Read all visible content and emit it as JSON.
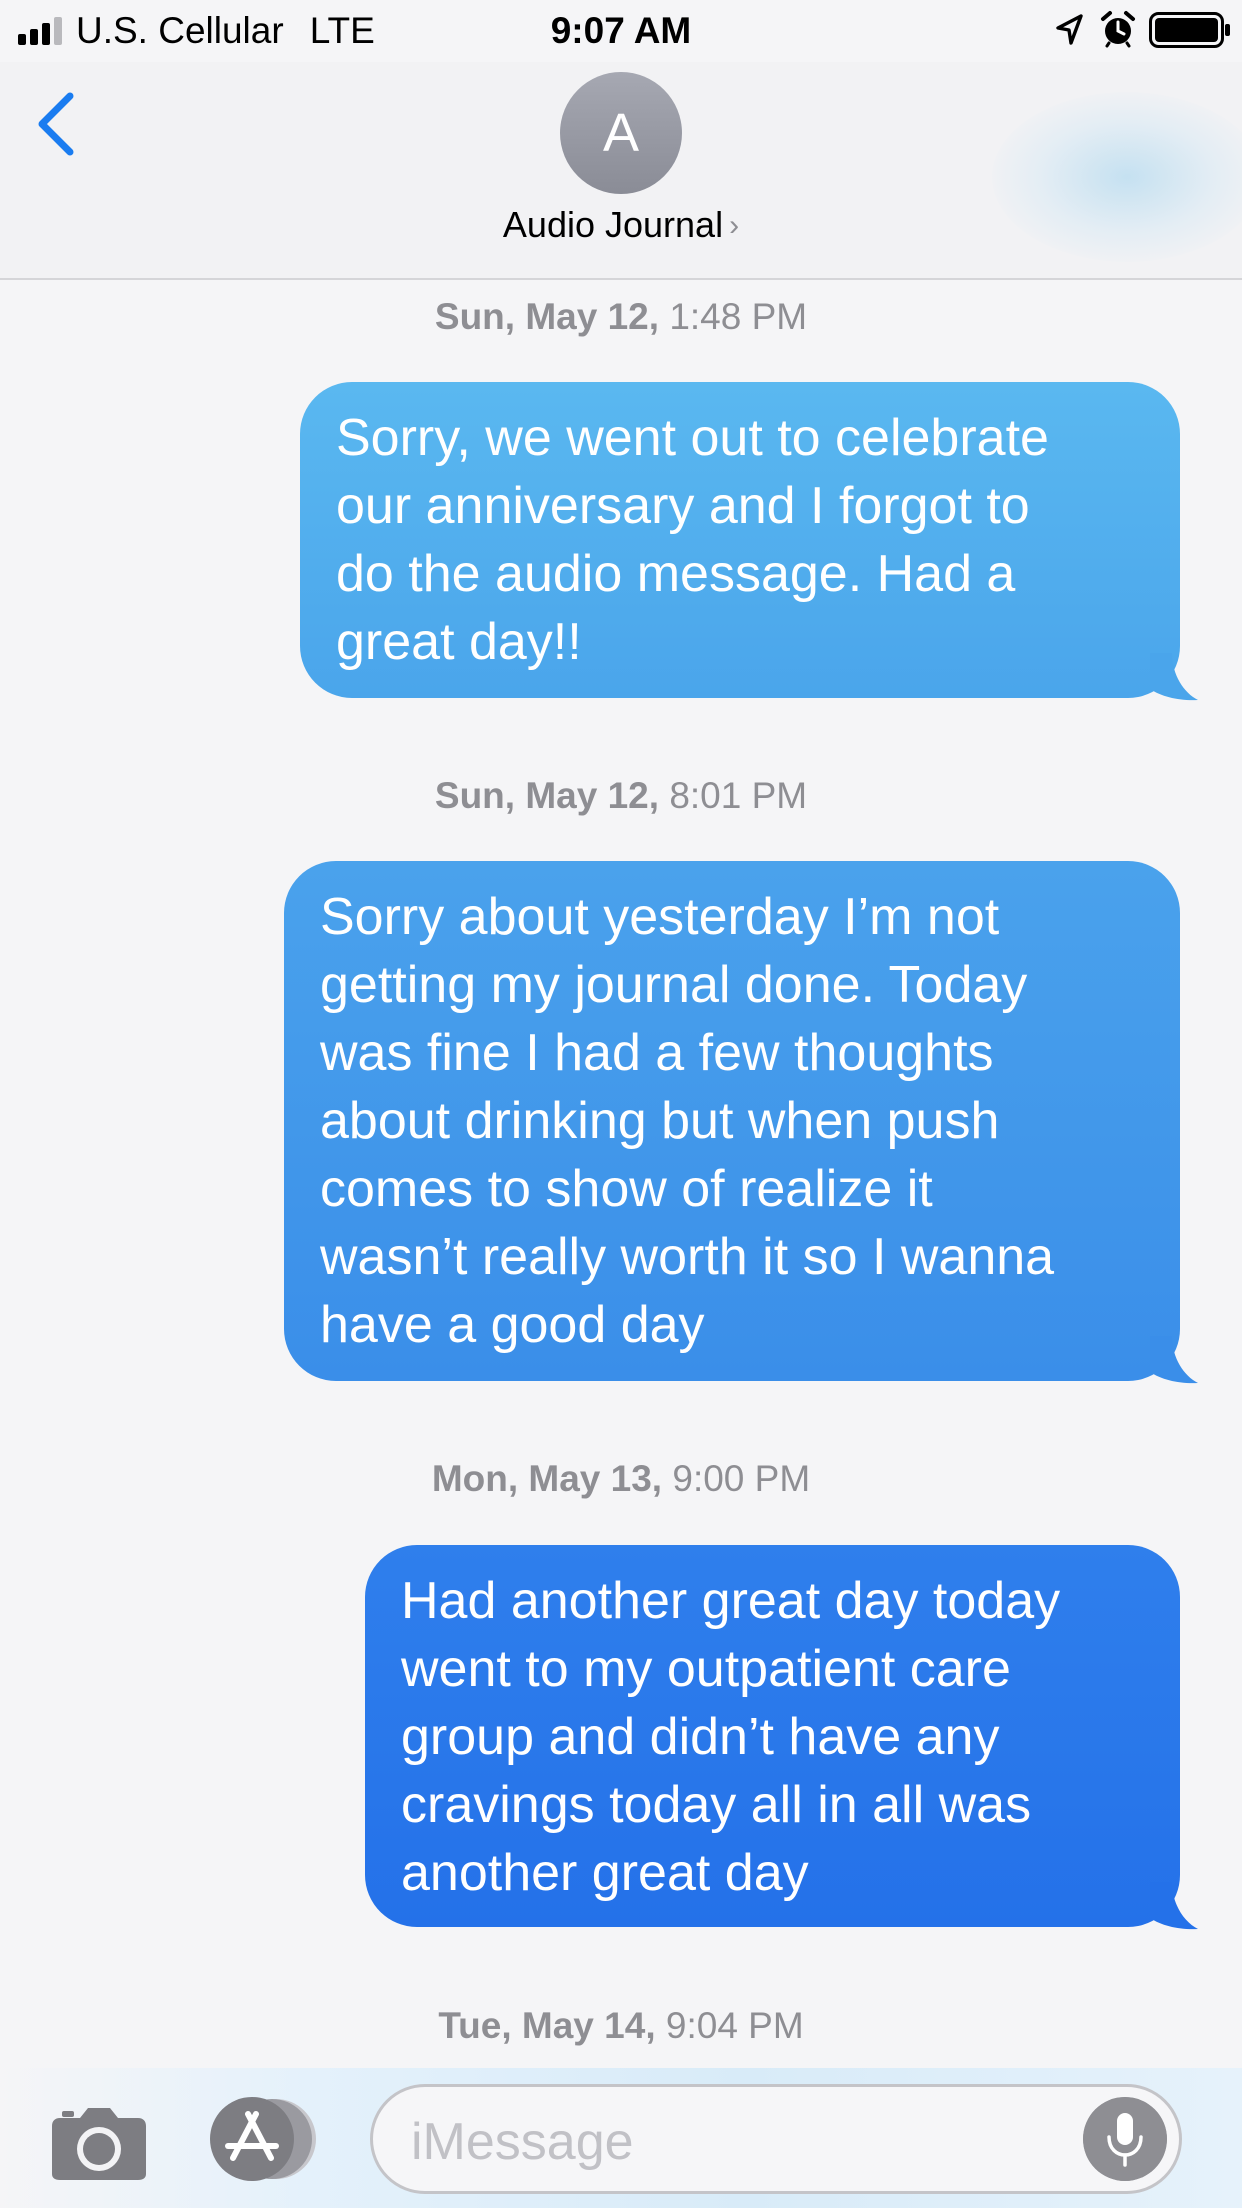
{
  "status_bar": {
    "carrier": "U.S. Cellular",
    "network": "LTE",
    "time": "9:07 AM",
    "signal_bars_active": 3,
    "signal_bars_total": 4,
    "icons": [
      "signal-icon",
      "location-icon",
      "alarm-icon",
      "battery-icon"
    ]
  },
  "header": {
    "avatar_initial": "A",
    "contact_name": "Audio Journal",
    "chevron": "›",
    "back_icon": "chevron-left-icon"
  },
  "messages": [
    {
      "day": "Sun, May 12,",
      "time": "1:48 PM",
      "text": "Sorry, we went out to celebrate our anniversary and I forgot to do the audio message. Had a great day!!",
      "lines": [
        "Sorry, we went out to celebrate",
        "our anniversary and I forgot to",
        "do the audio message. Had a",
        "great day!!"
      ]
    },
    {
      "day": "Sun, May 12,",
      "time": "8:01 PM",
      "text": "Sorry about yesterday I’m not getting my journal done. Today was fine I had a few thoughts about drinking but when push comes to show of realize it wasn’t really worth it so I wanna have a good day",
      "lines": [
        "Sorry about yesterday I’m not",
        "getting my journal done. Today",
        "was fine I had a few thoughts",
        "about drinking but when push",
        "comes to show of realize it",
        "wasn’t really worth it so I wanna",
        "have a good day"
      ]
    },
    {
      "day": "Mon, May 13,",
      "time": "9:00 PM",
      "text": "Had another great day today went to my outpatient care group and didn’t have any cravings today all in all was another great day",
      "lines": [
        "Had another great day today",
        "went to my outpatient care",
        "group and didn’t have any",
        "cravings today all in all was",
        "another great day"
      ]
    }
  ],
  "last_timestamp": {
    "day": "Tue, May 14,",
    "time": "9:04 PM"
  },
  "input_bar": {
    "placeholder": "iMessage",
    "icons": [
      "camera-icon",
      "app-store-icon",
      "microphone-icon"
    ]
  },
  "colors": {
    "accent": "#1a7cf0",
    "bubble_top": "#5ab8f0",
    "bubble_bottom": "#2471e9",
    "timestamp_gray": "#8e8e93"
  }
}
